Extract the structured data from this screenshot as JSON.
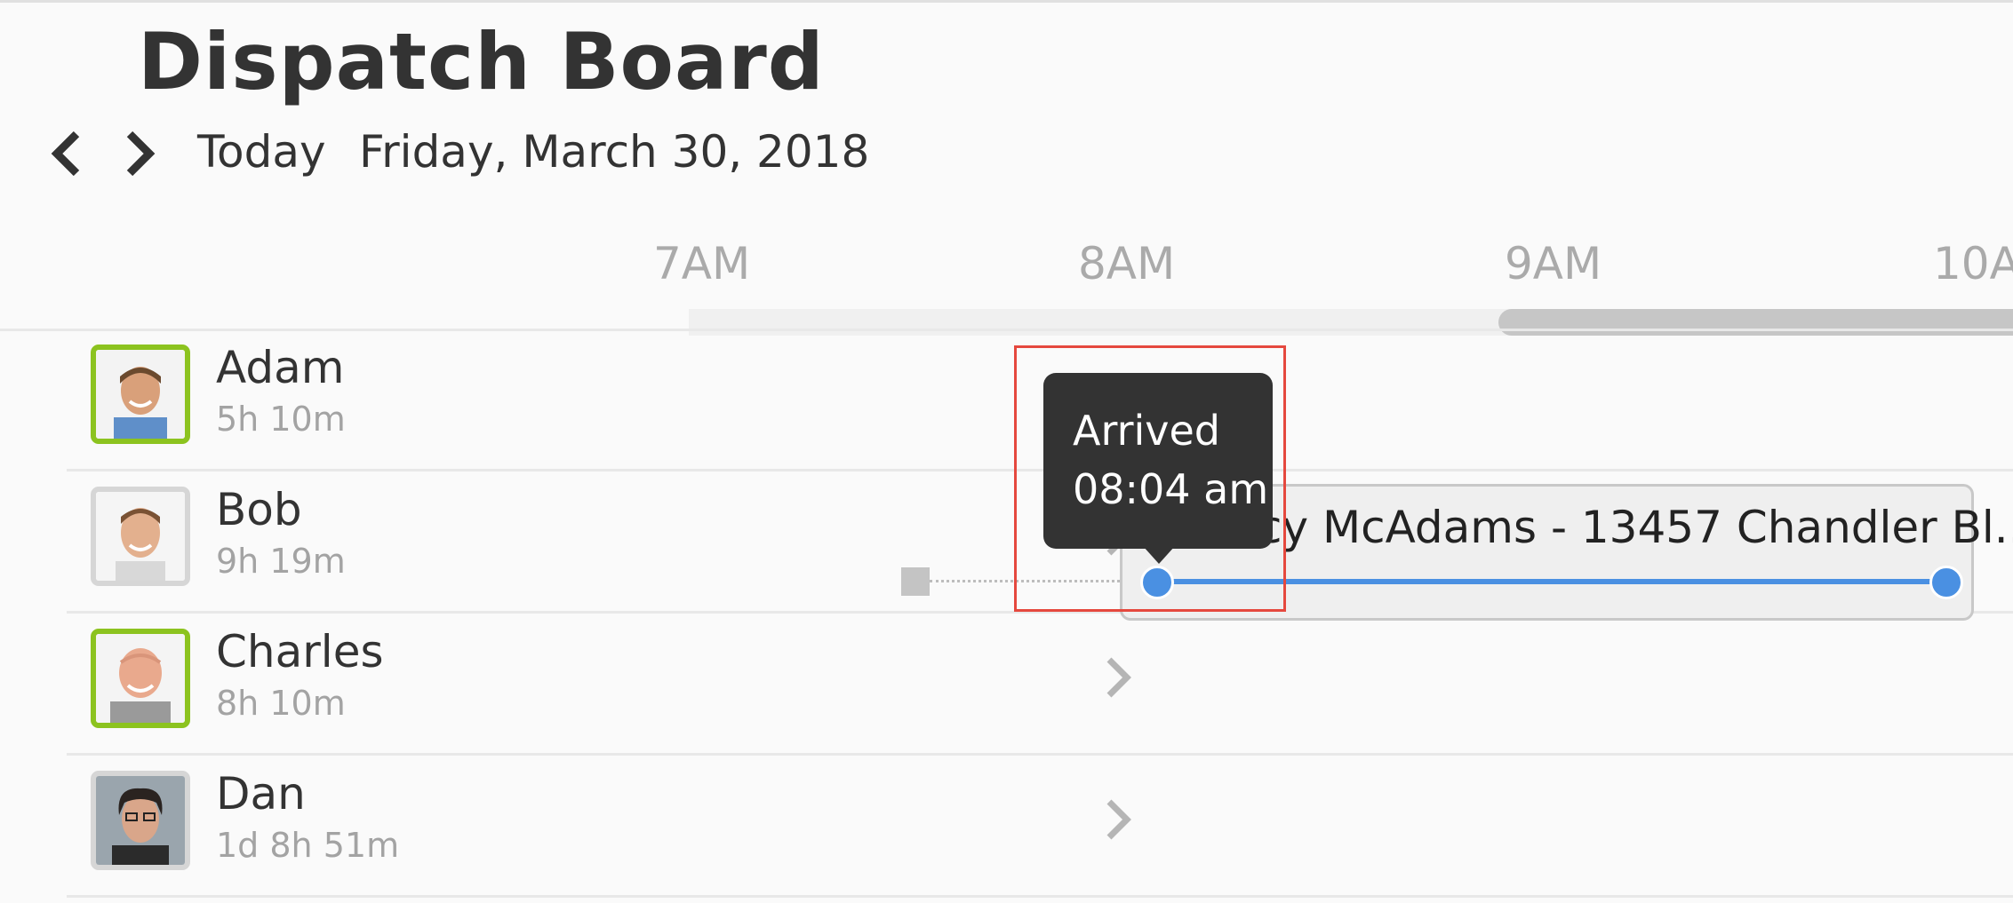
{
  "header": {
    "title": "Dispatch Board",
    "today_label": "Today",
    "date_label": "Friday, March 30, 2018",
    "prev_icon": "chevron-left-icon",
    "next_icon": "chevron-right-icon"
  },
  "timeline": {
    "hours": [
      "7AM",
      "8AM",
      "9AM",
      "10A"
    ]
  },
  "technicians": [
    {
      "name": "Adam",
      "hours": "5h 10m",
      "status": "active"
    },
    {
      "name": "Bob",
      "hours": "9h 19m",
      "status": "inactive"
    },
    {
      "name": "Charles",
      "hours": "8h 10m",
      "status": "active"
    },
    {
      "name": "Dan",
      "hours": "1d 8h 51m",
      "status": "inactive"
    }
  ],
  "job": {
    "title": "Stacy McAdams - 13457 Chandler Bl...",
    "checked": true
  },
  "tooltip": {
    "status": "Arrived",
    "time": "08:04 am"
  },
  "colors": {
    "active_border": "#8cc31f",
    "inactive_border": "#d6d6d6",
    "job_progress": "#4a90e2",
    "tooltip_bg": "#333333",
    "highlight": "#e5483e"
  }
}
